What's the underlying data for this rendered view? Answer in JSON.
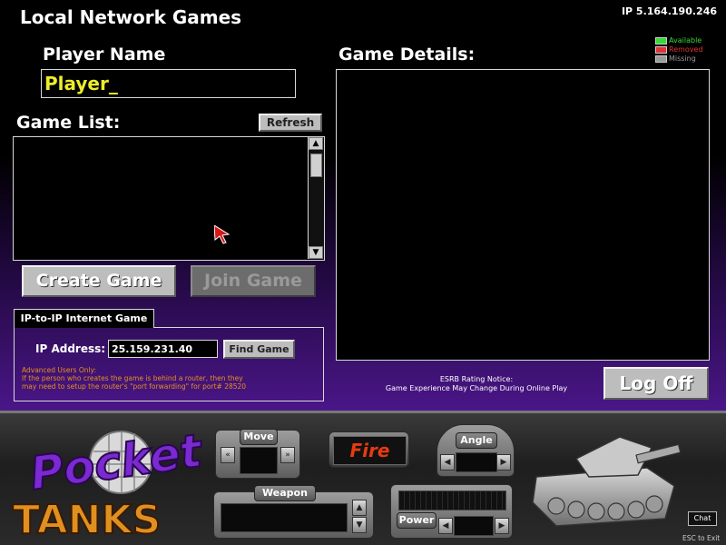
{
  "header": {
    "title": "Local Network Games",
    "ip_display": "IP 5.164.190.246"
  },
  "legend": [
    {
      "label": "Available",
      "color": "#39d739"
    },
    {
      "label": "Removed",
      "color": "#e23232"
    },
    {
      "label": "Missing",
      "color": "#9a9a9a"
    }
  ],
  "player": {
    "label": "Player Name",
    "value": "Player_"
  },
  "game_list": {
    "label": "Game List:",
    "refresh_label": "Refresh"
  },
  "actions": {
    "create_label": "Create Game",
    "join_label": "Join Game"
  },
  "game_details": {
    "label": "Game Details:"
  },
  "ip_game": {
    "tab_label": "IP-to-IP Internet Game",
    "address_label": "IP Address:",
    "address_value": "25.159.231.40",
    "find_label": "Find Game",
    "note_line1": "Advanced Users Only:",
    "note_line2": "If the person who creates the game is behind a router, then they",
    "note_line3": "may need to setup the router's \"port forwarding\" for port# 28520"
  },
  "esrb": {
    "line1": "ESRB Rating Notice:",
    "line2": "Game Experience May Change During Online Play"
  },
  "logoff_label": "Log Off",
  "deck": {
    "logo_line1": "Pocket",
    "logo_line2": "TANKS",
    "move_label": "Move",
    "fire_label": "Fire",
    "angle_label": "Angle",
    "weapon_label": "Weapon",
    "power_label": "Power",
    "chat_label": "Chat",
    "esc_label": "ESC to Exit"
  }
}
